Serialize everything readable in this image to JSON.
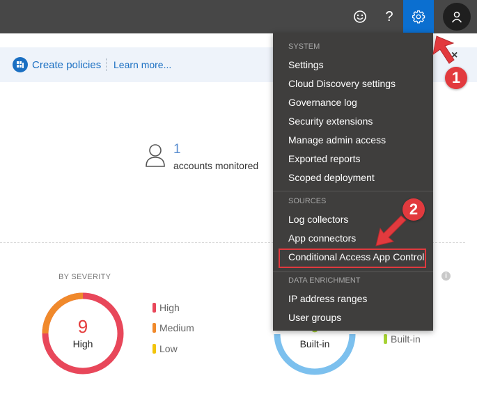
{
  "topbar": {
    "icons": [
      "smiley-icon",
      "help-icon",
      "gear-icon",
      "user-icon"
    ],
    "help_glyph": "?",
    "accent_color": "#0b6fd0"
  },
  "subbar": {
    "create_policies": "Create policies",
    "learn_more": "Learn more...",
    "close_glyph": "×"
  },
  "accounts": {
    "count": "1",
    "label": "accounts monitored"
  },
  "severity": {
    "title": "BY SEVERITY",
    "total": "9",
    "total_label": "High",
    "legend": [
      {
        "label": "High",
        "color": "#e8475a"
      },
      {
        "label": "Medium",
        "color": "#f0892b"
      },
      {
        "label": "Low",
        "color": "#f2c40a"
      }
    ]
  },
  "second_panel": {
    "center_label": "Built-in",
    "legend_label": "Built-in",
    "legend_color": "#a6d234",
    "ring_color": "#7cc0ee",
    "info_glyph": "i"
  },
  "settings_menu": {
    "sections": [
      {
        "header": "SYSTEM",
        "items": [
          "Settings",
          "Cloud Discovery settings",
          "Governance log",
          "Security extensions",
          "Manage admin access",
          "Exported reports",
          "Scoped deployment"
        ]
      },
      {
        "header": "SOURCES",
        "items": [
          "Log collectors",
          "App connectors",
          "Conditional Access App Control"
        ]
      },
      {
        "header": "DATA ENRICHMENT",
        "items": [
          "IP address ranges",
          "User groups"
        ]
      }
    ]
  },
  "annotations": {
    "callout_1": "1",
    "callout_2": "2",
    "color": "#e23a3e"
  }
}
